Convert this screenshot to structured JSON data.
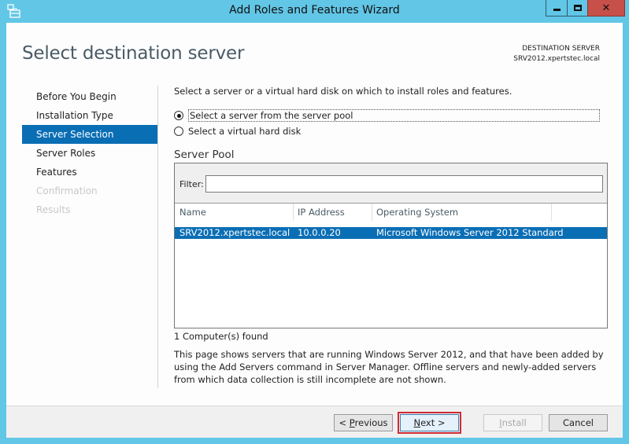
{
  "window": {
    "title": "Add Roles and Features Wizard",
    "icons": {
      "app": "server-manager-icon",
      "minimize": "minimize-icon",
      "maximize": "maximize-icon",
      "close": "close-icon"
    }
  },
  "header": {
    "title": "Select destination server",
    "destination_label": "DESTINATION SERVER",
    "destination_value": "SRV2012.xpertstec.local"
  },
  "nav": {
    "items": [
      {
        "label": "Before You Begin",
        "state": "normal"
      },
      {
        "label": "Installation Type",
        "state": "normal"
      },
      {
        "label": "Server Selection",
        "state": "active"
      },
      {
        "label": "Server Roles",
        "state": "normal"
      },
      {
        "label": "Features",
        "state": "normal"
      },
      {
        "label": "Confirmation",
        "state": "disabled"
      },
      {
        "label": "Results",
        "state": "disabled"
      }
    ]
  },
  "content": {
    "intro": "Select a server or a virtual hard disk on which to install roles and features.",
    "options": [
      {
        "label": "Select a server from the server pool",
        "checked": true
      },
      {
        "label": "Select a virtual hard disk",
        "checked": false
      }
    ],
    "pool_title": "Server Pool",
    "filter_label": "Filter:",
    "filter_value": "",
    "columns": [
      "Name",
      "IP Address",
      "Operating System"
    ],
    "rows": [
      {
        "name": "SRV2012.xpertstec.local",
        "ip": "10.0.0.20",
        "os": "Microsoft Windows Server 2012 Standard",
        "selected": true
      }
    ],
    "found": "1 Computer(s) found",
    "description": "This page shows servers that are running Windows Server 2012, and that have been added by using the Add Servers command in Server Manager. Offline servers and newly-added servers from which data collection is still incomplete are not shown."
  },
  "footer": {
    "previous": {
      "pre": "< ",
      "accel": "P",
      "rest": "revious"
    },
    "next": {
      "accel": "N",
      "rest": "ext >"
    },
    "install": {
      "accel": "I",
      "rest": "nstall"
    },
    "cancel": "Cancel"
  }
}
